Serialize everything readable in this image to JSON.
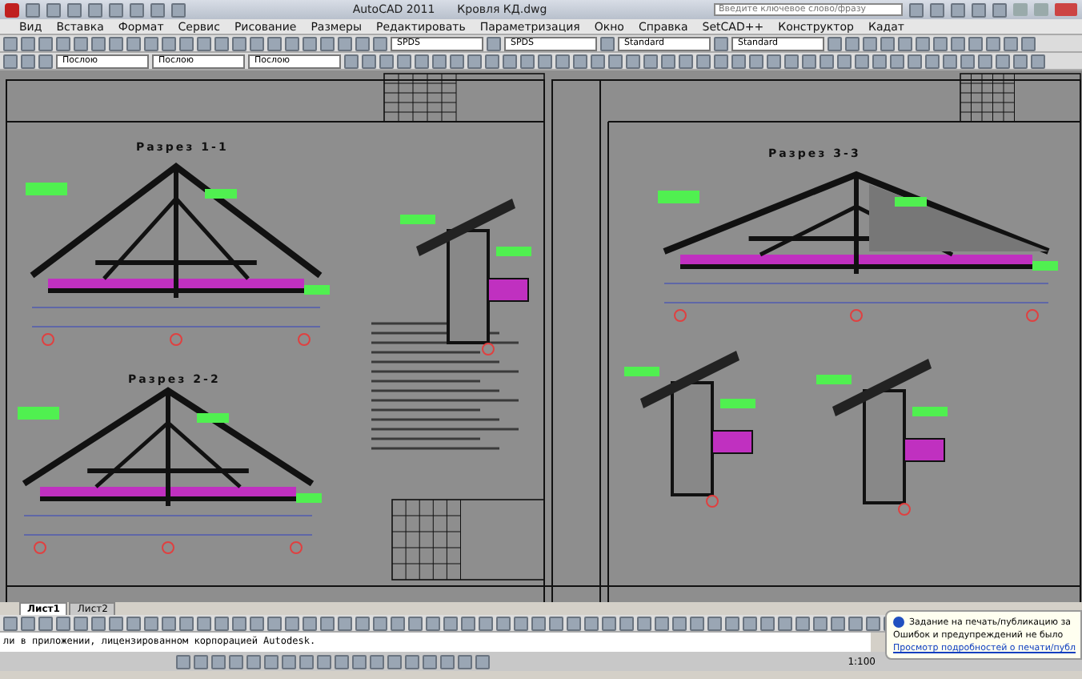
{
  "window": {
    "title": "AutoCAD 2011",
    "file": "Кровля КД.dwg",
    "search": {
      "placeholder": "Введите ключевое слово/фразу"
    }
  },
  "menu": [
    "Вид",
    "Вставка",
    "Формат",
    "Сервис",
    "Рисование",
    "Размеры",
    "Редактировать",
    "Параметризация",
    "Окно",
    "Справка",
    "SetCAD++",
    "Конструктор",
    "Кадат"
  ],
  "toolbar_styles": [
    "SPDS",
    "SPDS",
    "Standard",
    "Standard"
  ],
  "layer_props": [
    "Послою",
    "Послою",
    "Послою"
  ],
  "drawing": {
    "sections": [
      {
        "title": "Разрез 1-1"
      },
      {
        "title": "Разрез 2-2"
      },
      {
        "title": "Разрез 3-3"
      }
    ]
  },
  "layout_tabs": [
    {
      "label": "Лист1",
      "selected": true
    },
    {
      "label": "Лист2",
      "selected": false
    }
  ],
  "command_line": "ли в приложении, лицензированном корпорацией Autodesk.",
  "status_bar": {
    "scale": "1:100"
  },
  "notification": {
    "title": "Задание на печать/публикацию за",
    "message": "Ошибок и предупреждений не было",
    "link": "Просмотр подробностей о печати/публ"
  }
}
